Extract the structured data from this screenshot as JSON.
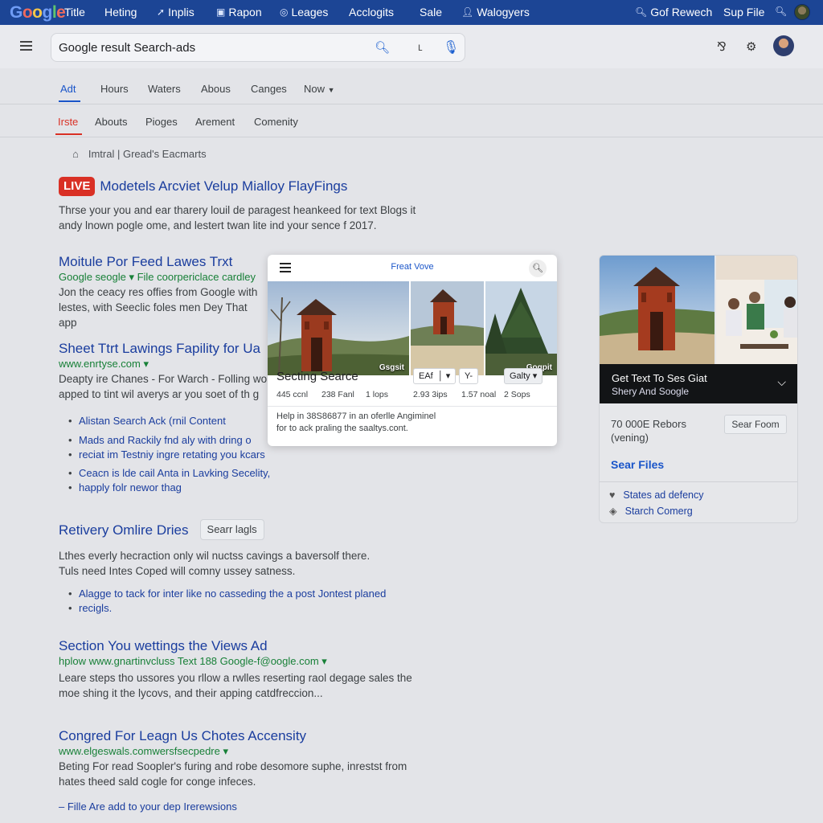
{
  "topbar": {
    "logo": "Google",
    "items": [
      {
        "label": "Title",
        "icon": ""
      },
      {
        "label": "Heting",
        "icon": ""
      },
      {
        "label": "Inplis",
        "icon": "rocket-icon"
      },
      {
        "label": "Rapon",
        "icon": "image-icon"
      },
      {
        "label": "Leages",
        "icon": "circle-icon"
      },
      {
        "label": "Acclogits",
        "icon": ""
      },
      {
        "label": "Sale",
        "icon": ""
      },
      {
        "label": "Walogyers",
        "icon": "user-icon"
      },
      {
        "label": "Gof Rewech",
        "icon": "search-icon"
      },
      {
        "label": "Sup File",
        "icon": ""
      }
    ]
  },
  "search": {
    "query": "Google result Search-ads"
  },
  "tabs_primary": [
    "Adt",
    "Hours",
    "Waters",
    "Abous",
    "Canges",
    "Now"
  ],
  "tabs_secondary": [
    "Irste",
    "Abouts",
    "Pioges",
    "Arement",
    "Comenity"
  ],
  "breadcrumb": "Imtral | Gread's Eacmarts",
  "results": [
    {
      "live": "LIVE",
      "title": "Modetels Arcviet Velup Mialloy FlayFings",
      "snippet": [
        "Thrse your you and ear tharery louil de paragest heankeed for text Blogs it",
        "andy lnown pogle ome, and lestert twan lite ind your sence f 2017."
      ]
    },
    {
      "title": "Moitule Por Feed Lawes Trxt",
      "url": "Google seogle ▾ File coorpericlace cardley",
      "snippet": [
        "Jon the ceacy res offies from Google with",
        "lestes, with Seeclic foles men Dey That app"
      ]
    },
    {
      "title": "Sheet Ttrt Lawings Fapility for Ua",
      "url": "www.enrtyse.com ▾",
      "snippet": [
        "Deapty ire Chanes - For Warch - Folling wo",
        "apped to tint wil averys ar you soet of th g"
      ],
      "bullets": [
        "Alistan Search Ack (rnil Content",
        "Mads and Rackily fnd aly with dring o",
        "reciat im Testniy ingre retating you kcars",
        "Ceacn is lde cail Anta in Lavking Secelity,",
        "happly folr newor thag"
      ]
    },
    {
      "title": "Retivery Omlire Dries",
      "chip": "Searr lagls",
      "snippet": [
        "Lthes everly hecraction only wil nuctss cavings a baversolf there.",
        "Tuls need Intes Coped will comny ussey satness."
      ],
      "bullets": [
        "Alagge to tack for inter like no casseding the a post Jontest planed",
        "recigls."
      ]
    },
    {
      "title": "Section You wettings the Views Ad",
      "url": "hplow www.gnartinvcluss   Text 188 Google-f@oogle.com ▾",
      "snippet": [
        "Leare steps tho ussores you rllow a rwlles reserting raol degage sales the",
        "moe shing it the lycovs, and their apping catdfreccion..."
      ]
    },
    {
      "title": "Congred For Leagn Us Chotes Accensity",
      "url": "www.elgeswals.comwersfsecpedre ▾",
      "snippet": [
        "Beting For read Soopler's furing and robe desomore suphe, inrestst from",
        "hates theed sald cogle for conge infeces."
      ],
      "footer": "– Fille Are add to your dep Irerewsions"
    }
  ],
  "popup": {
    "title": "Freat Vove",
    "photos": [
      {
        "caption": "Gsgsit"
      },
      {
        "caption": ""
      },
      {
        "caption": "Gogpit"
      }
    ],
    "heading": "Secting Searce",
    "buttons": [
      "EAf",
      "Y-",
      "Galty"
    ],
    "stats": [
      "445 ccnl",
      "238 Fanl",
      "1 lops",
      "2.93 3ips",
      "1.57 noal",
      "2 Sops"
    ],
    "help": [
      "Help in 38S86877 in an oferlle Angiminel",
      "for to ack praling the saaltys.cont."
    ]
  },
  "panel": {
    "banner_line1": "Get Text To Ses Giat",
    "banner_line2": "Shery And Soogle",
    "info_line1": "70 000E Rebors",
    "info_line2": "(vening)",
    "button": "Sear Foom",
    "files": "Sear Files",
    "links": [
      "States ad defency",
      "Starch Comerg"
    ]
  }
}
